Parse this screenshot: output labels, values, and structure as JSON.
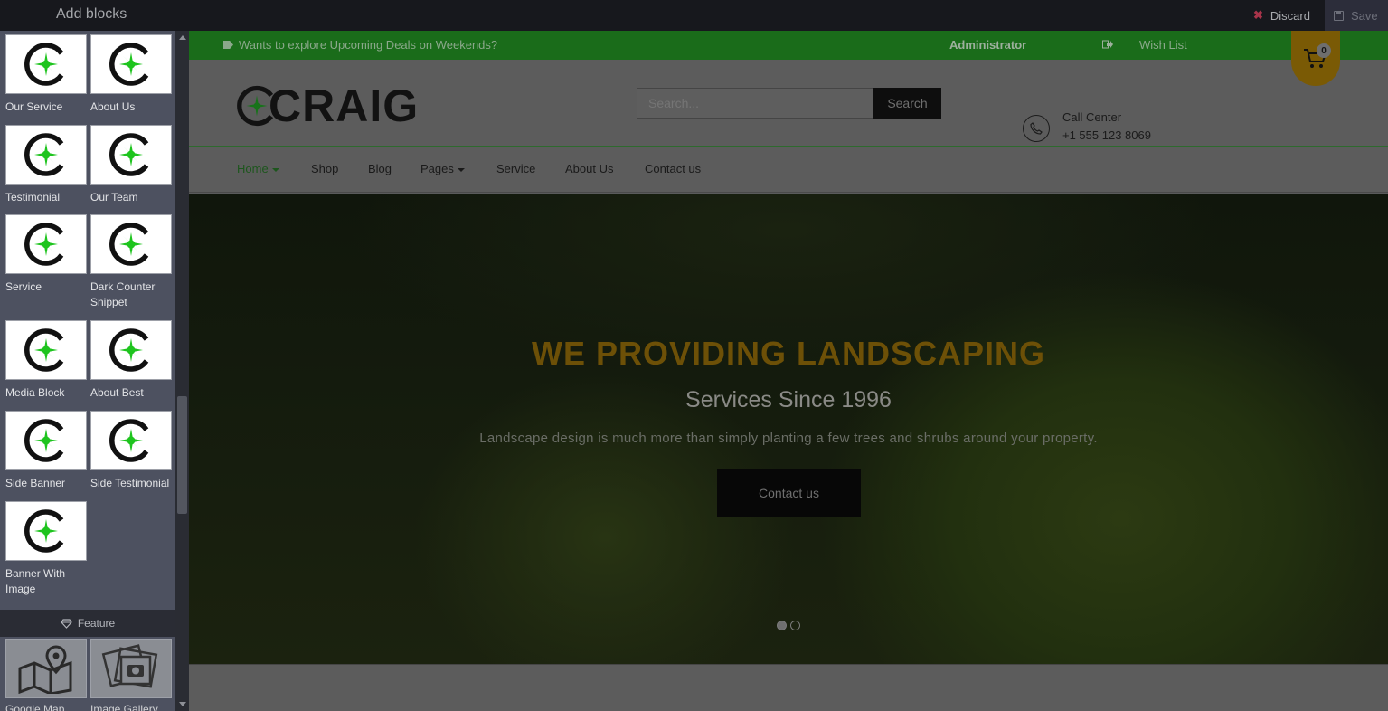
{
  "editor": {
    "title": "Add blocks",
    "discard_label": "Discard",
    "save_label": "Save"
  },
  "sidebar": {
    "blocks": [
      {
        "label": "Our Service"
      },
      {
        "label": "About Us"
      },
      {
        "label": "Testimonial"
      },
      {
        "label": "Our Team"
      },
      {
        "label": "Service"
      },
      {
        "label": "Dark Counter Snippet"
      },
      {
        "label": "Media Block"
      },
      {
        "label": "About Best"
      },
      {
        "label": "Side Banner"
      },
      {
        "label": "Side Testimonial"
      },
      {
        "label": "Banner With Image"
      }
    ],
    "feature_header": "Feature",
    "feature_blocks": [
      {
        "label": "Google Map",
        "icon": "map-icon"
      },
      {
        "label": "Image Gallery",
        "icon": "image-gallery-icon"
      }
    ]
  },
  "site": {
    "promo_text": "Wants to explore Upcoming Deals on Weekends?",
    "user": "Administrator",
    "wishlist": "Wish List",
    "brand": "CRAIG",
    "search_placeholder": "Search...",
    "search_button": "Search",
    "call_title": "Call Center",
    "call_number": "+1 555 123 8069",
    "cart_count": "0",
    "nav": [
      "Home",
      "Shop",
      "Blog",
      "Pages",
      "Service",
      "About Us",
      "Contact us"
    ],
    "hero": {
      "title": "WE PROVIDING LANDSCAPING",
      "subtitle": "Services Since 1996",
      "text": "Landscape design is much more than simply planting a few trees and shrubs around your property.",
      "cta": "Contact us"
    },
    "colors": {
      "promo_bar": "#1a6c1a",
      "accent_gold": "#c68f0f",
      "brand_green": "#2dbb2d"
    }
  }
}
